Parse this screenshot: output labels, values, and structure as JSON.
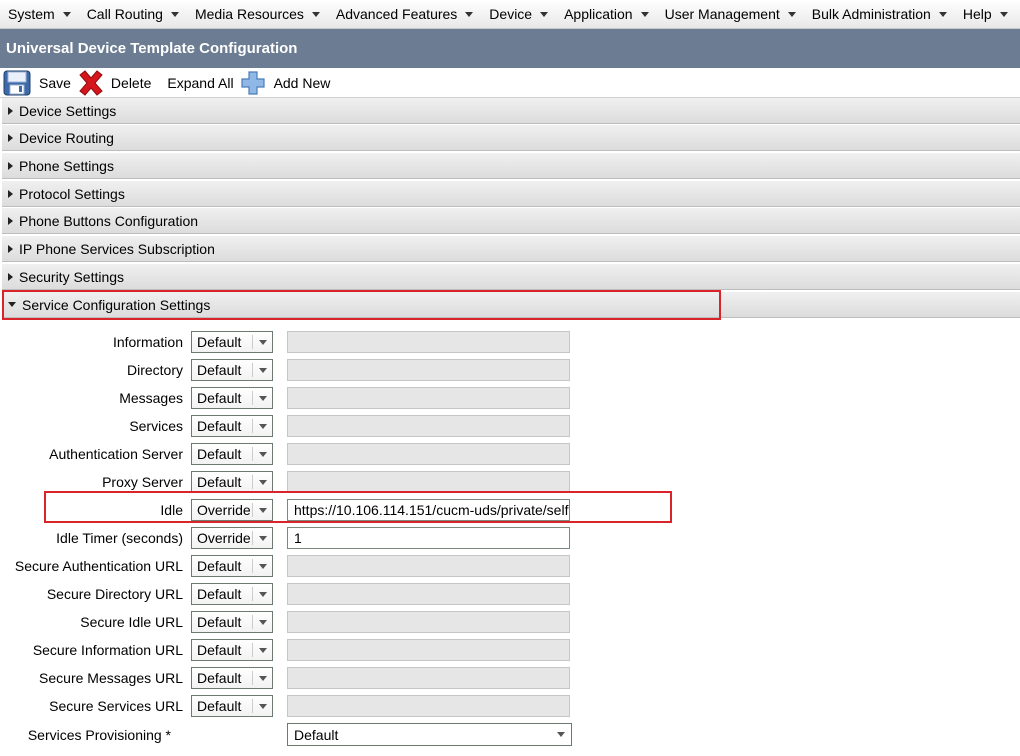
{
  "menu": [
    "System",
    "Call Routing",
    "Media Resources",
    "Advanced Features",
    "Device",
    "Application",
    "User Management",
    "Bulk Administration",
    "Help"
  ],
  "title": "Universal Device Template Configuration",
  "toolbar": {
    "save": "Save",
    "delete": "Delete",
    "expand_all": "Expand All",
    "add_new": "Add New"
  },
  "sections": [
    {
      "label": "Device Settings",
      "expanded": false
    },
    {
      "label": "Device Routing",
      "expanded": false
    },
    {
      "label": "Phone Settings",
      "expanded": false
    },
    {
      "label": "Protocol Settings",
      "expanded": false
    },
    {
      "label": "Phone Buttons Configuration",
      "expanded": false
    },
    {
      "label": "IP Phone Services Subscription",
      "expanded": false
    },
    {
      "label": "Security Settings",
      "expanded": false
    },
    {
      "label": "Service Configuration Settings",
      "expanded": true
    }
  ],
  "fields": [
    {
      "label": "Information",
      "mode": "Default",
      "value": ""
    },
    {
      "label": "Directory",
      "mode": "Default",
      "value": ""
    },
    {
      "label": "Messages",
      "mode": "Default",
      "value": ""
    },
    {
      "label": "Services",
      "mode": "Default",
      "value": ""
    },
    {
      "label": "Authentication Server",
      "mode": "Default",
      "value": ""
    },
    {
      "label": "Proxy Server",
      "mode": "Default",
      "value": ""
    },
    {
      "label": "Idle",
      "mode": "Override",
      "value": "https://10.106.114.151/cucm-uds/private/self"
    },
    {
      "label": "Idle Timer (seconds)",
      "mode": "Override",
      "value": "1"
    },
    {
      "label": "Secure Authentication URL",
      "mode": "Default",
      "value": ""
    },
    {
      "label": "Secure Directory URL",
      "mode": "Default",
      "value": ""
    },
    {
      "label": "Secure Idle URL",
      "mode": "Default",
      "value": ""
    },
    {
      "label": "Secure Information URL",
      "mode": "Default",
      "value": ""
    },
    {
      "label": "Secure Messages URL",
      "mode": "Default",
      "value": ""
    },
    {
      "label": "Secure Services URL",
      "mode": "Default",
      "value": ""
    }
  ],
  "provisioning": {
    "label": "Services Provisioning *",
    "value": "Default"
  },
  "colors": {
    "title_bg": "#6b7c93",
    "highlight": "#d9242c"
  }
}
